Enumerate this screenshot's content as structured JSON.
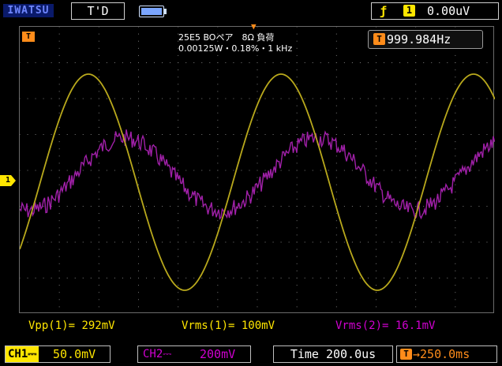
{
  "header": {
    "brand": "IWATSU",
    "trigger_status": "T'D",
    "battery_icon": "battery-icon",
    "trigger_edge_icon": "rising-edge-icon",
    "trigger_source": "1",
    "trigger_level": "0.00uV"
  },
  "annotation": {
    "line1": "25E5 BOペア　8Ω 負荷",
    "line2": "0.00125W・0.18%・1 kHz"
  },
  "frequency": {
    "label": "T",
    "value": "999.984Hz"
  },
  "markers": {
    "trigger_level": "T",
    "ch1": "1"
  },
  "measurements": [
    {
      "label": "Vpp(1)=",
      "value": "292mV",
      "color": "#ffe600"
    },
    {
      "label": "Vrms(1)=",
      "value": "100mV",
      "color": "#ffe600"
    },
    {
      "label": "Vrms(2)=",
      "value": "16.1mV",
      "color": "#d000d0"
    }
  ],
  "footer": {
    "ch1_label": "CH1",
    "ch1_coupling": "DC",
    "ch1_scale": "50.0mV",
    "ch2_label": "CH2",
    "ch2_coupling": "DC",
    "ch2_scale": "200mV",
    "timebase": "Time 200.0us",
    "delay_label": "T",
    "delay": "→250.0ms"
  },
  "colors": {
    "ch1": "#ffe600",
    "ch1_trace": "#b8a81c",
    "ch2": "#d000d0",
    "ch2_trace": "#a020a8",
    "trigger": "#ff8c1a",
    "grid": "#7a7a7a"
  },
  "waveforms": {
    "ch1": {
      "frequency_hz": 999.984,
      "vpp_mv": 292
    },
    "ch2": {
      "vrms_mv": 16.1
    }
  }
}
